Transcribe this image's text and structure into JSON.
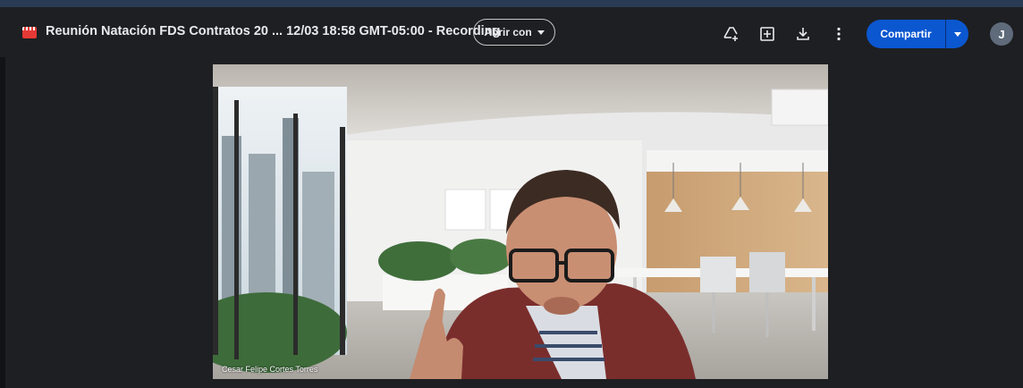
{
  "header": {
    "file_icon": "video-file-icon",
    "title": "Reunión Natación FDS Contratos 20 ... 12/03 18:58 GMT-05:00 - Recording",
    "open_with_label": "Abrir con",
    "actions": [
      "add-shortcut-icon",
      "add-to-folder-icon",
      "download-icon",
      "more-options-icon"
    ],
    "share_label": "Compartir",
    "avatar_initial": "J",
    "colors": {
      "share": "#0b57d0",
      "background": "#1e1f22",
      "file_icon": "#e53935"
    }
  },
  "video": {
    "participant_name": "Cesar Felipe Cortes Torres"
  }
}
